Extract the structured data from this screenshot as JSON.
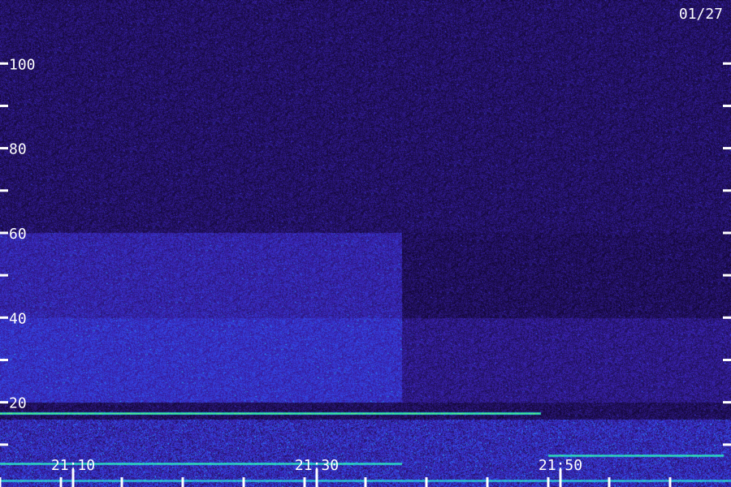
{
  "date_label": "01/27",
  "chart_data": {
    "type": "heatmap",
    "title": "",
    "xlabel": "",
    "ylabel": "",
    "ylim": [
      0,
      115
    ],
    "y_tick_labels": [
      "100",
      "80",
      "60",
      "40",
      "20"
    ],
    "y_ticks": [
      100,
      90,
      80,
      70,
      60,
      50,
      40,
      30,
      20,
      10
    ],
    "y_labeled_ticks": [
      100,
      80,
      60,
      40,
      20
    ],
    "x_time_range": [
      "21:04:00",
      "21:64:00"
    ],
    "x_tick_labels": [
      "21:10",
      "21:30",
      "21:50"
    ],
    "x_labeled_ticks": [
      "21:10",
      "21:30",
      "21:50"
    ],
    "x_ticks": [
      "21:04",
      "21:09",
      "21:14",
      "21:19",
      "21:24",
      "21:29",
      "21:34",
      "21:39",
      "21:44",
      "21:49",
      "21:54",
      "21:59"
    ],
    "colormap": [
      "#0a0020",
      "#20105a",
      "#3a22b0",
      "#3050f0",
      "#20c0e0",
      "#40f080",
      "#e0ff40"
    ],
    "intensity_regions": [
      {
        "y_range": [
          60,
          115
        ],
        "level": 0.18
      },
      {
        "y_range": [
          40,
          60
        ],
        "x_range_fraction": [
          0,
          0.55
        ],
        "level": 0.32
      },
      {
        "y_range": [
          20,
          40
        ],
        "x_range_fraction": [
          0,
          0.55
        ],
        "level": 0.38
      },
      {
        "y_range": [
          20,
          40
        ],
        "x_range_fraction": [
          0.55,
          1
        ],
        "level": 0.25
      }
    ],
    "horizontal_lines": [
      {
        "y": 17.5,
        "level": 0.85,
        "x_range_fraction": [
          0,
          0.74
        ]
      },
      {
        "y": 5.5,
        "level": 0.8,
        "x_range_fraction": [
          0,
          0.55
        ]
      },
      {
        "y": 7.5,
        "level": 0.8,
        "x_range_fraction": [
          0.75,
          0.99
        ]
      },
      {
        "y": 1.5,
        "level": 0.75,
        "x_range_fraction": [
          0,
          1
        ]
      }
    ]
  }
}
